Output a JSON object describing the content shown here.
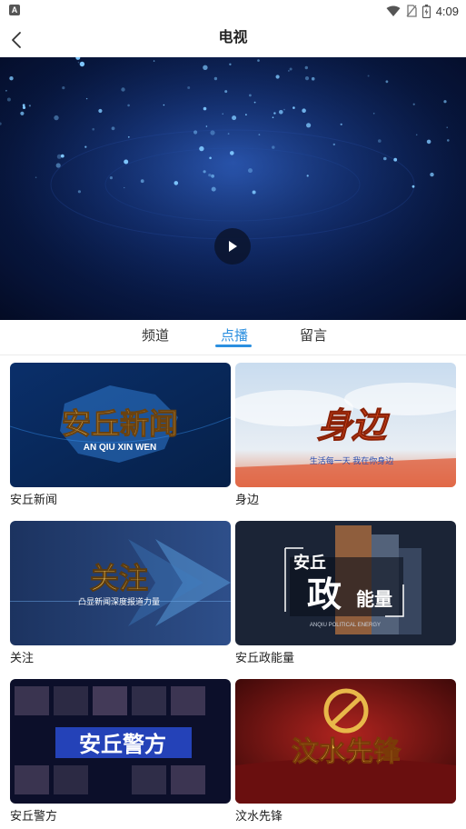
{
  "status_bar": {
    "time": "4:09",
    "left_badge": "A"
  },
  "header": {
    "title": "电视"
  },
  "player": {
    "state": "paused"
  },
  "tabs": [
    {
      "label": "频道",
      "active": false
    },
    {
      "label": "点播",
      "active": true
    },
    {
      "label": "留言",
      "active": false
    }
  ],
  "programs": [
    {
      "title": "安丘新闻",
      "thumb_text": "安丘新闻",
      "thumb_sub": "AN  QIU  XIN  WEN"
    },
    {
      "title": "身边",
      "thumb_text": "身边",
      "thumb_sub": "生活每一天  我在你身边"
    },
    {
      "title": "关注",
      "thumb_text": "关注",
      "thumb_sub": "凸显新闻深度报道力量"
    },
    {
      "title": "安丘政能量",
      "thumb_text": "政",
      "thumb_sub": "ANQIU POLITICAL ENERGY"
    },
    {
      "title": "安丘警方",
      "thumb_text": "安丘警方"
    },
    {
      "title": "汶水先锋",
      "thumb_text": "汶水先锋"
    }
  ],
  "thumb_extra": {
    "anqiu": "安丘",
    "nengliang": "能量"
  },
  "colors": {
    "accent": "#2b8fe0"
  }
}
